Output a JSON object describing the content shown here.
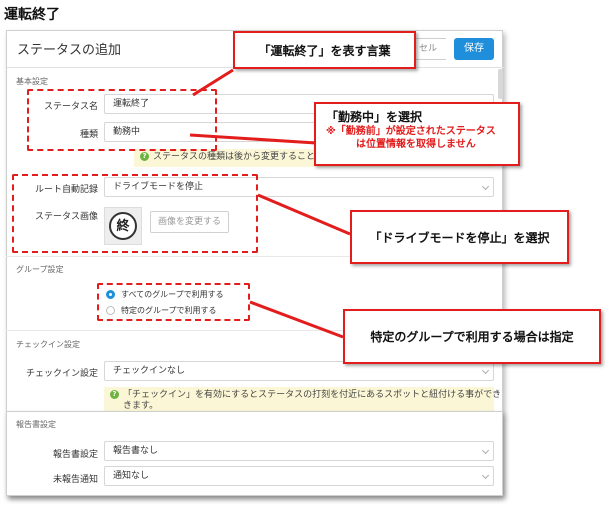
{
  "page_heading": "運転終了",
  "dialog": {
    "title": "ステータスの追加",
    "cancel_label": "セル",
    "save_label": "保存"
  },
  "basic": {
    "section_label": "基本設定",
    "status_name_label": "ステータス名",
    "status_name_value": "運転終了",
    "type_label": "種類",
    "type_value": "勤務中",
    "type_hint": "ステータスの種類は後から変更することは出来ま",
    "route_label": "ルート自動記録",
    "route_value": "ドライブモードを停止",
    "image_label": "ステータス画像",
    "image_glyph": "終",
    "change_image_label": "画像を変更する"
  },
  "group": {
    "section_label": "グループ設定",
    "options": [
      "すべてのグループで利用する",
      "特定のグループで利用する"
    ],
    "selected_index": 0
  },
  "checkin": {
    "section_label": "チェックイン設定",
    "setting_label": "チェックイン設定",
    "setting_value": "チェックインなし",
    "hint_line1": "「チェックイン」を有効にするとステータスの打刻を付近にあるスポットと紐付ける事ができ",
    "hint_line2": "きます。"
  },
  "report": {
    "section_label": "報告書設定",
    "setting_label": "報告書設定",
    "setting_value": "報告書なし",
    "notify_label": "未報告通知",
    "notify_value": "通知なし"
  },
  "callouts": {
    "name_words": "「運転終了」を表す言葉",
    "kinmu_title": "「勤務中」を選択",
    "kinmu_note1": "※「勤務前」が設定されたステータス",
    "kinmu_note2": "は位置情報を取得しません",
    "drive_mode": "「ドライブモードを停止」を選択",
    "group_specific": "特定のグループで利用する場合は指定"
  },
  "colors": {
    "accent": "#1f8fdc",
    "annotation_red": "#e31c1c",
    "hint_bg": "#fbf7d6"
  }
}
